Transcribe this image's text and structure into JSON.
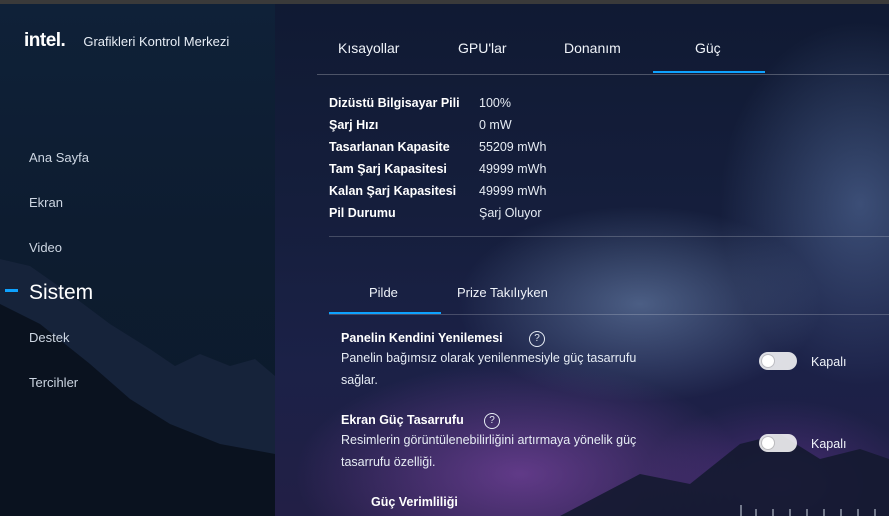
{
  "brand": {
    "logo": "intel.",
    "app_title": "Grafikleri Kontrol Merkezi"
  },
  "sidebar": {
    "items": [
      {
        "label": "Ana Sayfa"
      },
      {
        "label": "Ekran"
      },
      {
        "label": "Video"
      },
      {
        "label": "Sistem",
        "active": true
      },
      {
        "label": "Destek"
      },
      {
        "label": "Tercihler"
      }
    ]
  },
  "tabs": [
    {
      "label": "Kısayollar"
    },
    {
      "label": "GPU'lar"
    },
    {
      "label": "Donanım"
    },
    {
      "label": "Güç",
      "active": true
    }
  ],
  "battery_info": [
    {
      "key": "Dizüstü Bilgisayar Pili",
      "value": "100%"
    },
    {
      "key": "Şarj Hızı",
      "value": "0 mW"
    },
    {
      "key": "Tasarlanan Kapasite",
      "value": "55209 mWh"
    },
    {
      "key": "Tam Şarj Kapasitesi",
      "value": "49999 mWh"
    },
    {
      "key": "Kalan Şarj Kapasitesi",
      "value": "49999 mWh"
    },
    {
      "key": "Pil Durumu",
      "value": "Şarj Oluyor"
    }
  ],
  "subtabs": [
    {
      "label": "Pilde",
      "active": true
    },
    {
      "label": "Prize Takılıyken"
    }
  ],
  "settings": [
    {
      "title": "Panelin Kendini Yenilemesi",
      "help": "?",
      "desc_line1": "Panelin bağımsız olarak yenilenmesiyle güç tasarrufu",
      "desc_line2": "sağlar.",
      "toggle_state": "Kapalı"
    },
    {
      "title": "Ekran Güç Tasarrufu",
      "help": "?",
      "desc_line1": "Resimlerin görüntülenebilirliğini artırmaya yönelik güç",
      "desc_line2": "tasarrufu özelliği.",
      "toggle_state": "Kapalı"
    }
  ],
  "power_efficiency": {
    "label": "Güç Verimliliği"
  },
  "colors": {
    "accent": "#0ea2ff"
  }
}
